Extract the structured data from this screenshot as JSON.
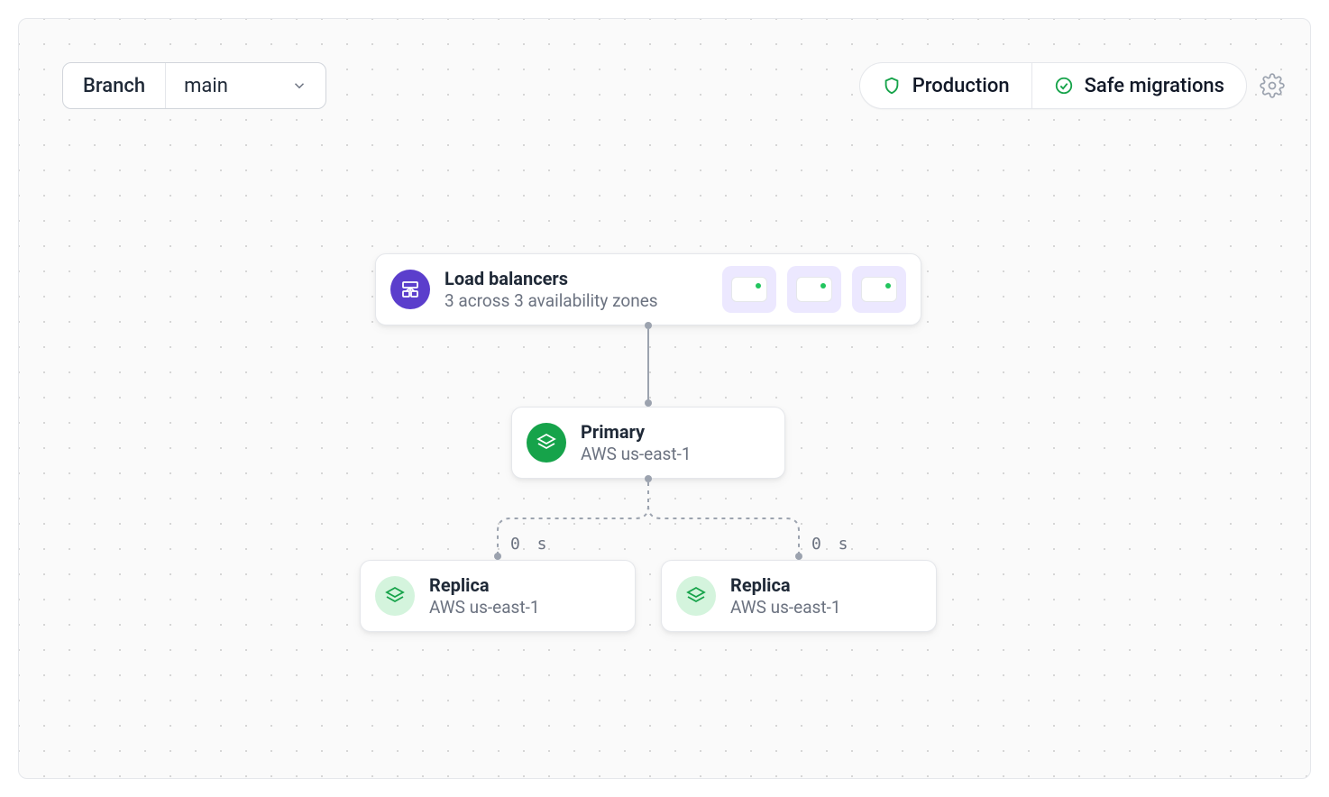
{
  "branch": {
    "label": "Branch",
    "value": "main"
  },
  "pills": {
    "production": "Production",
    "safe_migrations": "Safe migrations"
  },
  "lb": {
    "title": "Load balancers",
    "subtitle": "3 across 3 availability zones"
  },
  "primary": {
    "title": "Primary",
    "subtitle": "AWS us-east-1"
  },
  "replicas": [
    {
      "title": "Replica",
      "subtitle": "AWS us-east-1",
      "latency": "0 s"
    },
    {
      "title": "Replica",
      "subtitle": "AWS us-east-1",
      "latency": "0 s"
    }
  ]
}
